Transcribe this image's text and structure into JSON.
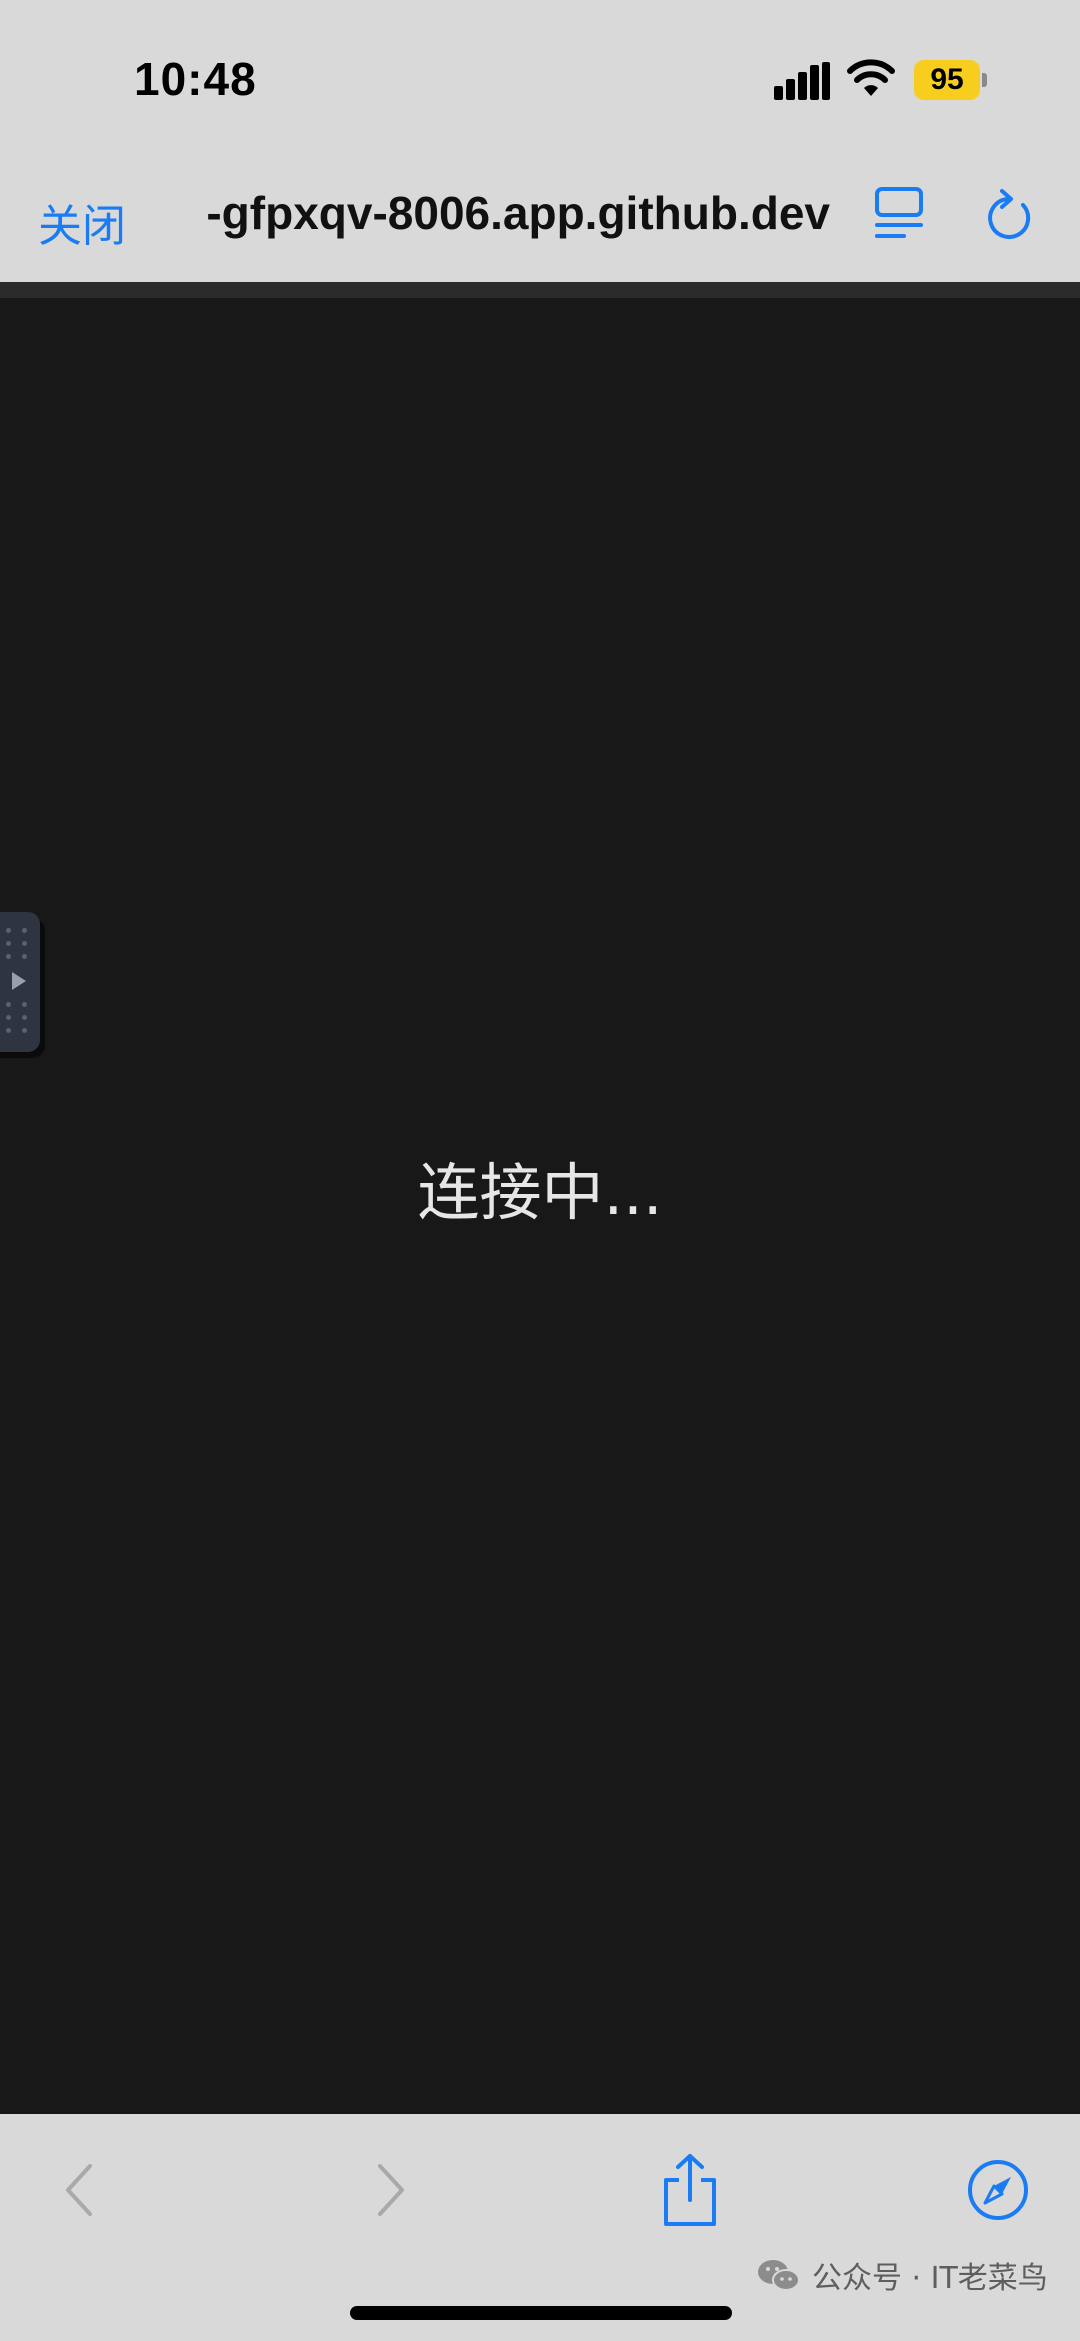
{
  "status_bar": {
    "time": "10:48",
    "battery_level": "95",
    "signal_icon": "cellular-signal-icon",
    "wifi_icon": "wifi-icon",
    "battery_color": "#f7ce1e"
  },
  "nav_bar": {
    "close_label": "关闭",
    "url": "-gfpxqv-8006.app.github.dev",
    "reader_icon": "reader-mode-icon",
    "reload_icon": "reload-icon",
    "accent_color": "#1a7cf2"
  },
  "content": {
    "status_text": "连接中...",
    "background_color": "#181818",
    "side_handle_icon": "play-icon"
  },
  "toolbar": {
    "back_icon": "chevron-left-icon",
    "forward_icon": "chevron-right-icon",
    "share_icon": "share-icon",
    "safari_icon": "compass-icon"
  },
  "watermark": {
    "icon": "wechat-icon",
    "text": "公众号 · IT老菜鸟"
  }
}
